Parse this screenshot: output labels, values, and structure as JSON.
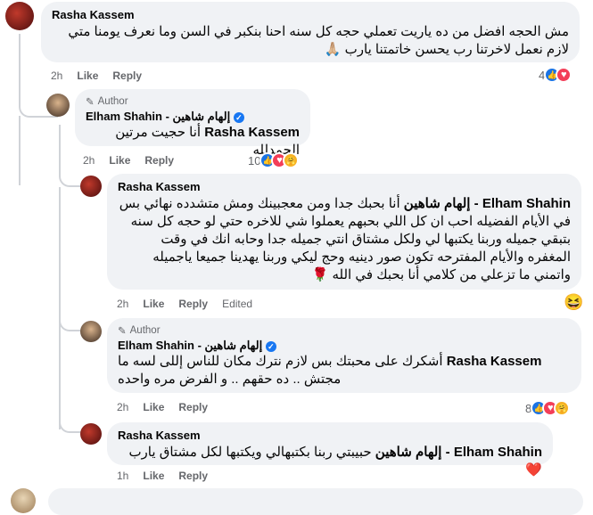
{
  "comments": [
    {
      "author": "Rasha Kassem",
      "text": "مش الحجه افضل من ده ياريت تعملي حجه كل سنه احنا بنكبر في السن وما نعرف يومنا متي لازم نعمل لاخرتنا رب يحسن خاتمتنا يارب 🙏🏼",
      "time": "2h",
      "like_label": "Like",
      "reply_label": "Reply",
      "reaction_count": "4"
    },
    {
      "author_badge": "Author",
      "author": "Elham Shahin - إلهام شاهين",
      "text_tag": "Rasha Kassem",
      "text": "أنا حجيت مرتين الحمدلله",
      "time": "2h",
      "like_label": "Like",
      "reply_label": "Reply",
      "reaction_count": "10"
    },
    {
      "author": "Rasha Kassem",
      "text_tag": "Elham Shahin - إلهام شاهين",
      "text": "أنا بحبك جدا ومن معجبينك ومش متشدده نهائي بس في الأيام الفضيله احب ان كل اللي بحبهم يعملوا شي للاخره حتي لو حجه كل سنه بتبقي جميله وربنا يكتبها لي ولكل مشتاق انتي جميله جدا وحابه انك في وقت المغفره والأيام المفترحه تكون صور دينيه وحج ليكي وربنا يهدينا جميعا ياجميله واتمني ما تزعلي من كلامي أنا بحبك في الله 🌹",
      "time": "2h",
      "like_label": "Like",
      "reply_label": "Reply",
      "edited_label": "Edited"
    },
    {
      "author_badge": "Author",
      "author": "Elham Shahin - إلهام شاهين",
      "text_tag": "Rasha Kassem",
      "text": "أشكرك على محبتك بس لازم نترك مكان للناس إللى لسه ما مجتش .. ده حقهم .. و الفرض مره واحده",
      "time": "2h",
      "like_label": "Like",
      "reply_label": "Reply",
      "reaction_count": "8"
    },
    {
      "author": "Rasha Kassem",
      "text_tag": "Elham Shahin - إلهام شاهين",
      "text": "حبيبتي ربنا بكتبهالي ويكتبها لكل مشتاق يارب ❤️",
      "time": "1h",
      "like_label": "Like",
      "reply_label": "Reply"
    }
  ],
  "icons": {
    "pencil": "✎",
    "verified": "✓",
    "like": "👍",
    "heart": "♥",
    "care": "🤗",
    "laugh": "😆",
    "emoji_react": "😆"
  }
}
